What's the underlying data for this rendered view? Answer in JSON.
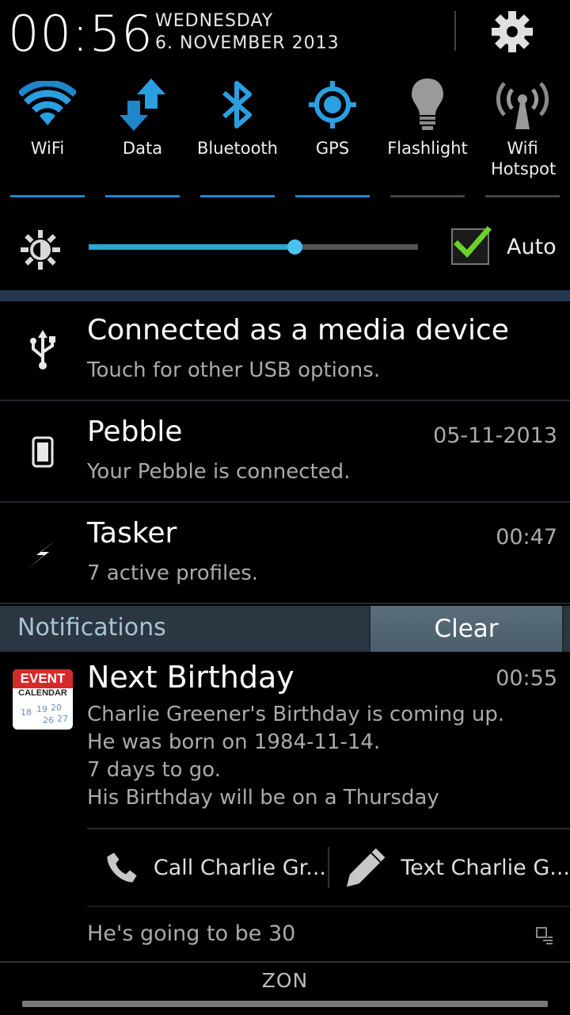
{
  "header": {
    "time": "00:56",
    "weekday": "WEDNESDAY",
    "date": "6. NOVEMBER 2013",
    "settings_icon": "gear-icon"
  },
  "toggles": [
    {
      "label": "WiFi",
      "icon": "wifi-icon",
      "on": true
    },
    {
      "label": "Data",
      "icon": "data-arrows-icon",
      "on": true
    },
    {
      "label": "Bluetooth",
      "icon": "bluetooth-icon",
      "on": true
    },
    {
      "label": "GPS",
      "icon": "gps-icon",
      "on": true
    },
    {
      "label": "Flashlight",
      "icon": "flashlight-icon",
      "on": false
    },
    {
      "label": "Wifi Hotspot",
      "icon": "hotspot-icon",
      "on": false
    }
  ],
  "brightness": {
    "level_fraction": 0.625,
    "auto_label": "Auto",
    "auto_checked": true
  },
  "ongoing": [
    {
      "title": "Connected as a media device",
      "text": "Touch for other USB options.",
      "time": "",
      "icon": "usb-icon"
    },
    {
      "title": "Pebble",
      "text": "Your Pebble is connected.",
      "time": "05-11-2013",
      "icon": "pebble-watch-icon"
    },
    {
      "title": "Tasker",
      "text": "7 active profiles.",
      "time": "00:47",
      "icon": "lightning-icon"
    }
  ],
  "notifications": {
    "header_label": "Notifications",
    "clear_label": "Clear"
  },
  "birthday": {
    "icon_top": "EVENT",
    "icon_sub": "CALENDAR",
    "title": "Next Birthday",
    "time": "00:55",
    "lines": [
      "Charlie Greener's Birthday is coming up.",
      "He was born on 1984-11-14.",
      "7 days to go.",
      "His Birthday will be on a Thursday"
    ],
    "action_call": "Call Charlie Gr...",
    "action_text": "Text Charlie G...",
    "footer": "He's going to be 30"
  },
  "carrier": "ZON",
  "colors": {
    "accent_blue": "#1f86c9",
    "check_green": "#6cd12a",
    "header_bg": "#2a3742"
  }
}
